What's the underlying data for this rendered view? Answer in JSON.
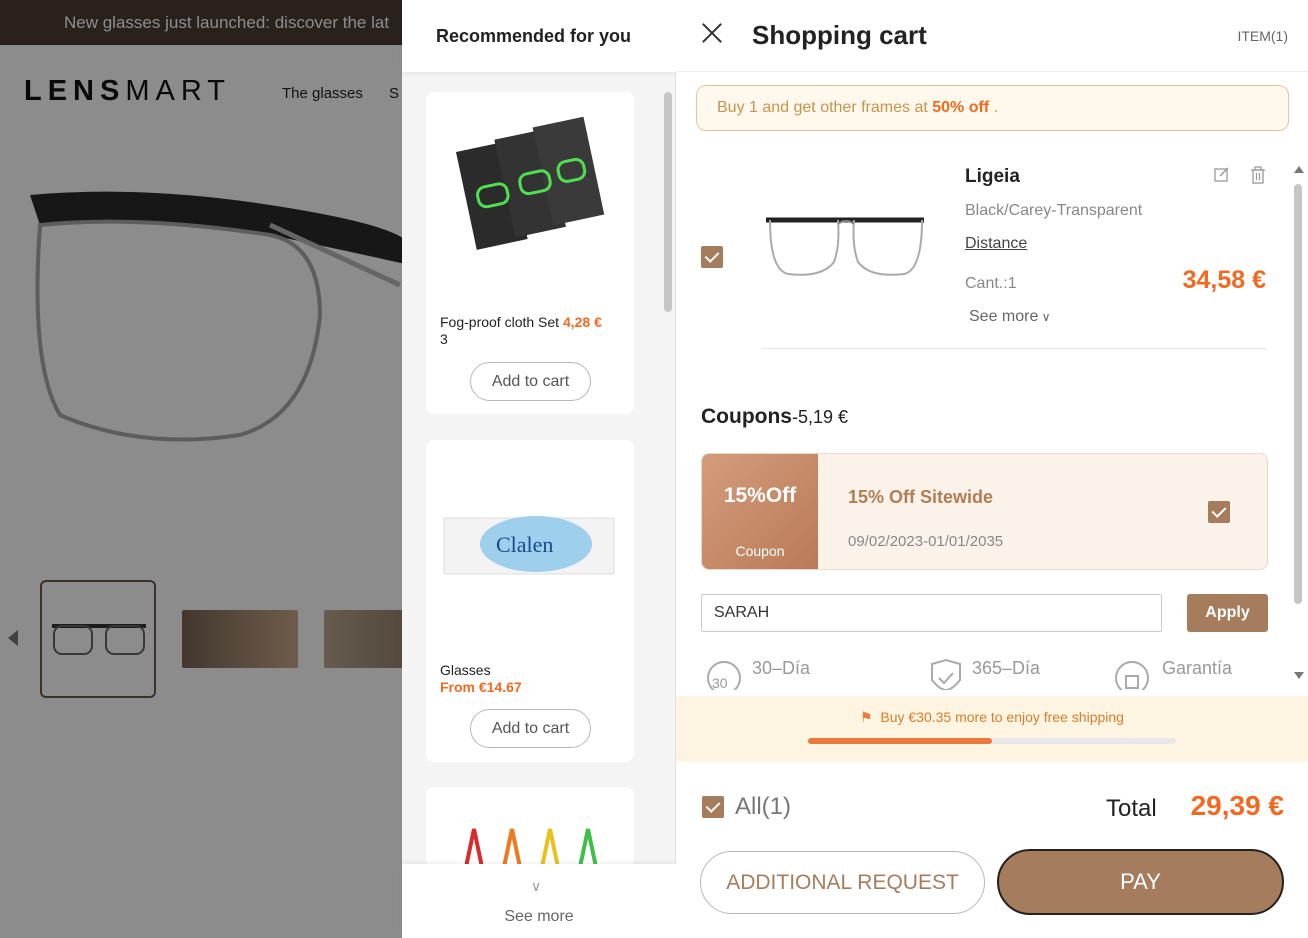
{
  "background": {
    "banner": "New glasses just launched: discover the lat",
    "logo_bold": "LENS",
    "logo_thin": "MART",
    "nav": [
      "The glasses",
      "S"
    ]
  },
  "recommended": {
    "title": "Recommended for you",
    "items": [
      {
        "name": "Fog-proof cloth Set",
        "price": "4,28 €",
        "extra": "3",
        "button": "Add to cart"
      },
      {
        "name": "Glasses",
        "price": "From €14.67",
        "button": "Add to cart"
      },
      {
        "name": ""
      }
    ],
    "see_more": "See more"
  },
  "cart": {
    "title": "Shopping cart",
    "item_count": "ITEM(1)",
    "promo_pre": "Buy 1 and get other frames at ",
    "promo_bold": "50% off",
    "promo_post": " .",
    "item": {
      "name": "Ligeia",
      "variant": "Black/Carey-Transparent",
      "lens": "Distance",
      "qty": "Cant.:1",
      "price": "34,58 €",
      "see_more": "See more"
    },
    "coupons": {
      "label": "Coupons",
      "discount": "-5,19 €",
      "card": {
        "pct": "15%Off",
        "tag": "Coupon",
        "name": "15% Off Sitewide",
        "dates": "09/02/2023-01/01/2035"
      },
      "code_value": "SARAH",
      "apply": "Apply"
    },
    "guarantees": [
      "30–Día",
      "365–Día",
      "Garantía"
    ],
    "shipping": {
      "text": "Buy €30.35 more to enjoy free shipping",
      "progress": 0.5
    },
    "all_label": "All(1)",
    "total_label": "Total",
    "total_value": "29,39 €",
    "request_button": "ADDITIONAL REQUEST",
    "pay_button": "PAY"
  },
  "colors": {
    "accent": "#a57d5d",
    "price": "#f26a22",
    "banner": "#4b3c33"
  }
}
